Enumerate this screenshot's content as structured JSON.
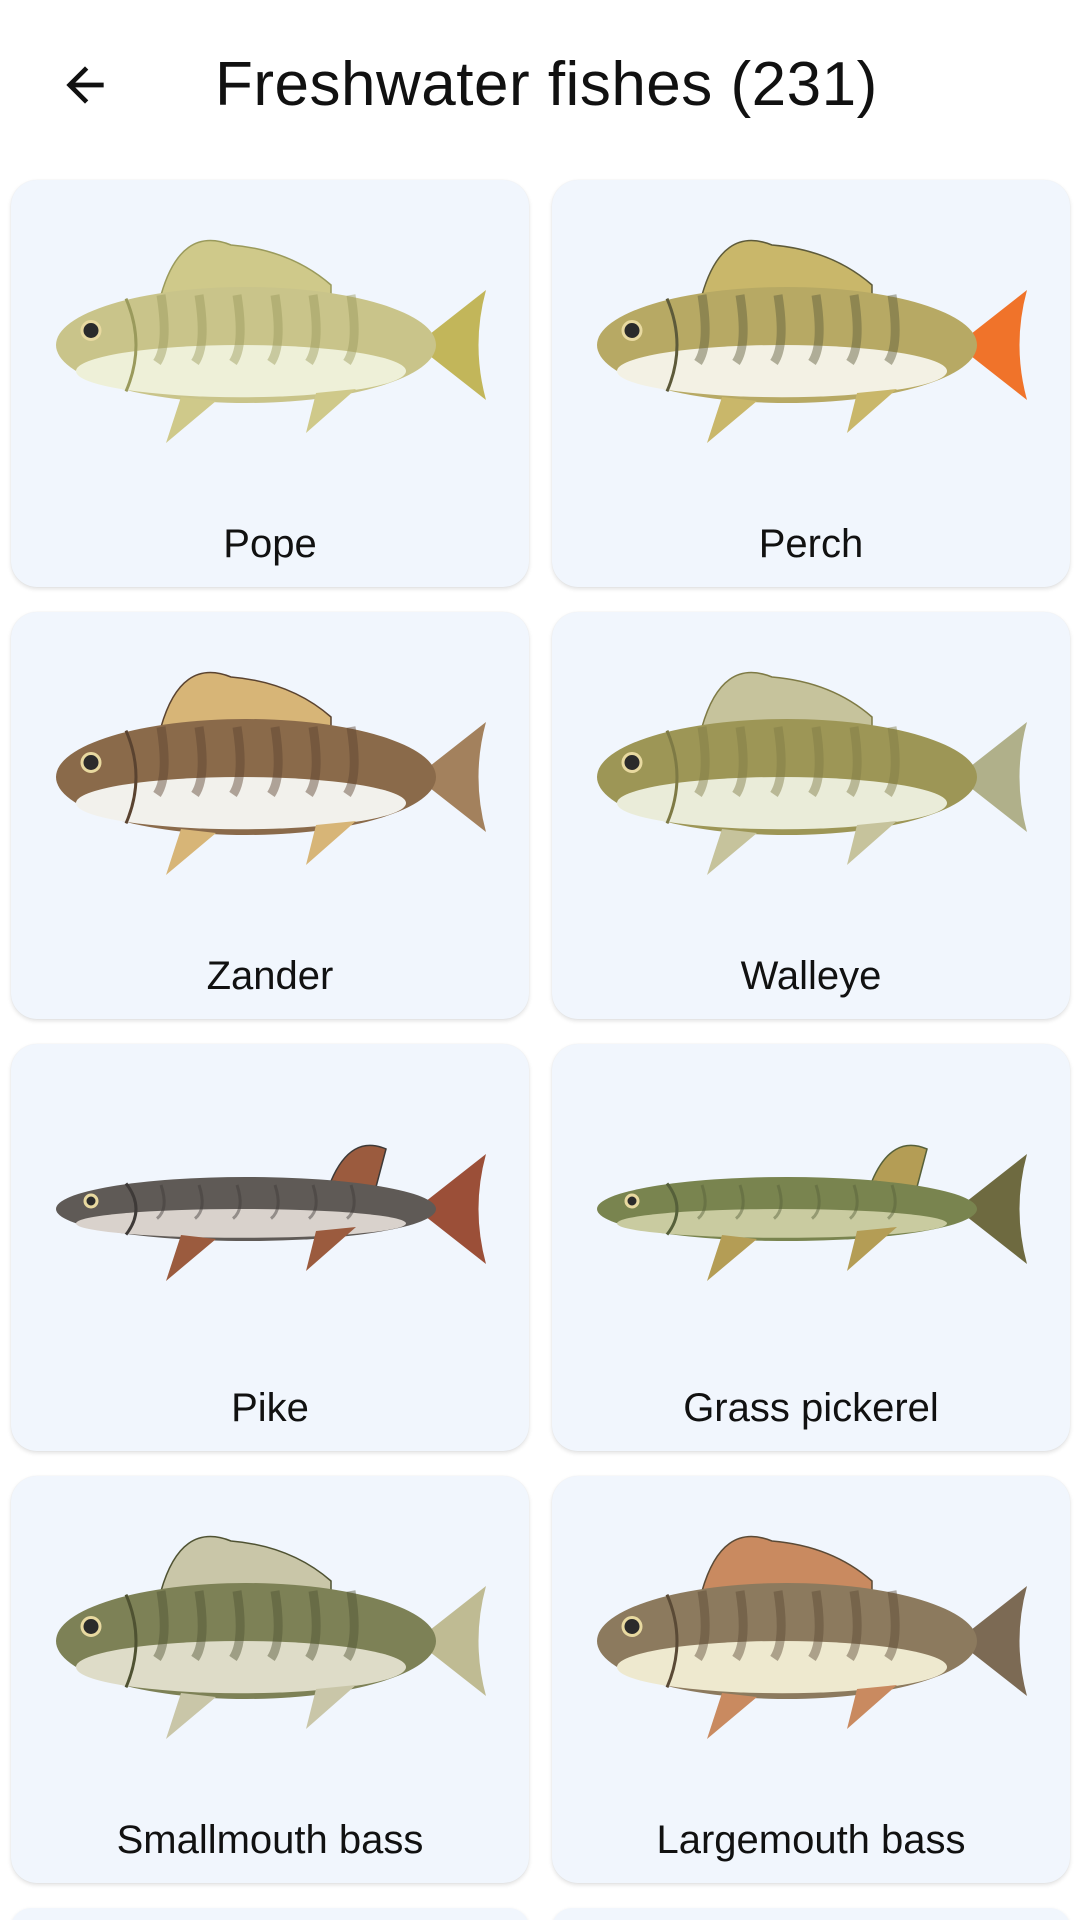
{
  "header": {
    "back_icon": "arrow-left-icon",
    "title": "Freshwater fishes (231)"
  },
  "fishes": [
    {
      "label": "Pope",
      "body": "#c9c48a",
      "belly": "#eef0d8",
      "fin": "#cfc98a",
      "tail": "#c2b65a",
      "stripe": "#9a9a5c"
    },
    {
      "label": "Perch",
      "body": "#b7a964",
      "belly": "#f3f1e4",
      "fin": "#c9b76a",
      "tail": "#f0732a",
      "stripe": "#5d5a3a"
    },
    {
      "label": "Zander",
      "body": "#8a6a4a",
      "belly": "#f2f1ec",
      "fin": "#d7b577",
      "tail": "#a3815d",
      "stripe": "#5a4330"
    },
    {
      "label": "Walleye",
      "body": "#9d9656",
      "belly": "#eaecd9",
      "fin": "#c6c39c",
      "tail": "#b0b08a",
      "stripe": "#7e7a45"
    },
    {
      "label": "Pike",
      "body": "#5f5a56",
      "belly": "#d9d2cc",
      "fin": "#9b5b3e",
      "tail": "#9b4f38",
      "stripe": "#3e3a38"
    },
    {
      "label": "Grass pickerel",
      "body": "#79844f",
      "belly": "#c9cba0",
      "fin": "#b49d55",
      "tail": "#6e6a40",
      "stripe": "#56603a"
    },
    {
      "label": "Smallmouth bass",
      "body": "#7d8156",
      "belly": "#dedcc8",
      "fin": "#c9c6a8",
      "tail": "#bfbb93",
      "stripe": "#4f5232"
    },
    {
      "label": "Largemouth bass",
      "body": "#8c7a5e",
      "belly": "#eee9cf",
      "fin": "#c98a60",
      "tail": "#7c6a54",
      "stripe": "#5a4a36"
    }
  ]
}
